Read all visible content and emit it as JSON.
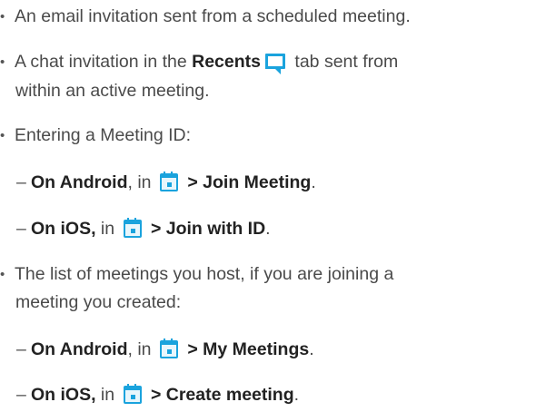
{
  "items": [
    {
      "type": "bullet",
      "text": "An email invitation sent from a scheduled meeting."
    },
    {
      "type": "bullet",
      "before": "A chat invitation in the ",
      "bold": "Recents",
      "icon": "chat-icon",
      "after": " tab sent from",
      "continuation": "within an active meeting."
    },
    {
      "type": "bullet",
      "text": "Entering a Meeting ID:"
    },
    {
      "type": "sub",
      "bold_prefix": "On Android",
      "middle": ", in ",
      "icon": "calendar-icon",
      "bold_suffix": " > Join Meeting",
      "end": "."
    },
    {
      "type": "sub",
      "bold_prefix": "On iOS,",
      "middle": " in ",
      "icon": "calendar-icon",
      "bold_suffix": " > Join with ID",
      "end": "."
    },
    {
      "type": "bullet",
      "text": "The list of meetings you host, if you are joining a",
      "continuation": "meeting you created:"
    },
    {
      "type": "sub",
      "bold_prefix": "On Android",
      "middle": ", in ",
      "icon": "calendar-icon",
      "bold_suffix": " > My Meetings",
      "end": "."
    },
    {
      "type": "sub",
      "bold_prefix": "On iOS,",
      "middle": " in ",
      "icon": "calendar-icon",
      "bold_suffix": " > Create meeting",
      "end": "."
    }
  ],
  "glyphs": {
    "bullet": "•",
    "dash": "–"
  },
  "colors": {
    "icon_blue": "#1aa3dd",
    "text": "#4a4a4a",
    "bold_text": "#222222"
  }
}
